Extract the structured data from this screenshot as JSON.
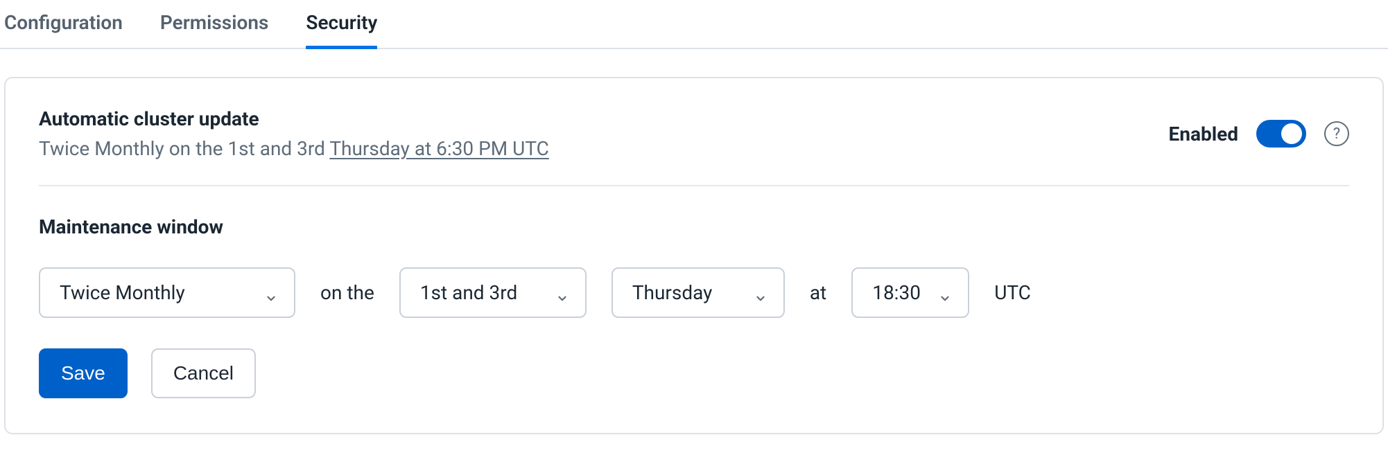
{
  "tabs": {
    "configuration": "Configuration",
    "permissions": "Permissions",
    "security": "Security"
  },
  "auto_update": {
    "title": "Automatic cluster update",
    "subtitle_prefix": "Twice Monthly on the 1st and 3rd ",
    "subtitle_link": "Thursday at 6:30 PM UTC",
    "enabled_label": "Enabled",
    "enabled": true,
    "help_glyph": "?"
  },
  "maintenance": {
    "title": "Maintenance window",
    "connector_on_the": "on the",
    "connector_at": "at",
    "tz_label": "UTC",
    "frequency_selected": "Twice Monthly",
    "ordinal_selected": "1st and 3rd",
    "day_selected": "Thursday",
    "time_selected": "18:30"
  },
  "actions": {
    "save": "Save",
    "cancel": "Cancel"
  }
}
